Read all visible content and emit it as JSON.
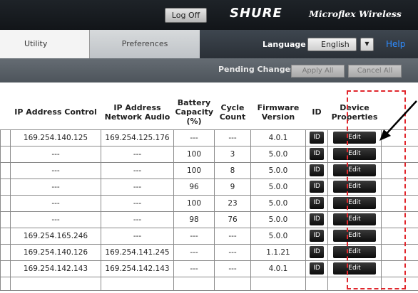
{
  "header": {
    "logoff_label": "Log Off",
    "brand": "SHURE",
    "product": "Microflex Wireless"
  },
  "tabs": {
    "utility": "Utility",
    "preferences": "Preferences"
  },
  "language": {
    "label": "Language",
    "selected": "English",
    "dropdown_glyph": "▼"
  },
  "help_label": "Help",
  "pending": {
    "label": "Pending Changes:",
    "apply_all": "Apply All",
    "cancel_all": "Cancel All"
  },
  "table": {
    "columns": {
      "ip_control": "IP Address Control",
      "ip_audio": "IP Address Network Audio",
      "battery": "Battery Capacity (%)",
      "cycle": "Cycle Count",
      "firmware": "Firmware Version",
      "id": "ID",
      "device": "Device Properties"
    },
    "rows": [
      {
        "ip_control": "169.254.140.125",
        "ip_audio": "169.254.125.176",
        "battery": "---",
        "cycle": "---",
        "firmware": "4.0.1",
        "id": "ID",
        "edit": "Edit"
      },
      {
        "ip_control": "---",
        "ip_audio": "---",
        "battery": "100",
        "cycle": "3",
        "firmware": "5.0.0",
        "id": "ID",
        "edit": "Edit"
      },
      {
        "ip_control": "---",
        "ip_audio": "---",
        "battery": "100",
        "cycle": "8",
        "firmware": "5.0.0",
        "id": "ID",
        "edit": "Edit"
      },
      {
        "ip_control": "---",
        "ip_audio": "---",
        "battery": "96",
        "cycle": "9",
        "firmware": "5.0.0",
        "id": "ID",
        "edit": "Edit"
      },
      {
        "ip_control": "---",
        "ip_audio": "---",
        "battery": "100",
        "cycle": "23",
        "firmware": "5.0.0",
        "id": "ID",
        "edit": "Edit"
      },
      {
        "ip_control": "---",
        "ip_audio": "---",
        "battery": "98",
        "cycle": "76",
        "firmware": "5.0.0",
        "id": "ID",
        "edit": "Edit"
      },
      {
        "ip_control": "169.254.165.246",
        "ip_audio": "---",
        "battery": "---",
        "cycle": "---",
        "firmware": "5.0.0",
        "id": "ID",
        "edit": "Edit"
      },
      {
        "ip_control": "169.254.140.126",
        "ip_audio": "169.254.141.245",
        "battery": "---",
        "cycle": "---",
        "firmware": "1.1.21",
        "id": "ID",
        "edit": "Edit"
      },
      {
        "ip_control": "169.254.142.143",
        "ip_audio": "169.254.142.143",
        "battery": "---",
        "cycle": "---",
        "firmware": "4.0.1",
        "id": "ID",
        "edit": "Edit"
      }
    ]
  },
  "colors": {
    "help_link": "#2e8cff",
    "annotation": "#e1262c",
    "topbar": "#1a1e22"
  }
}
